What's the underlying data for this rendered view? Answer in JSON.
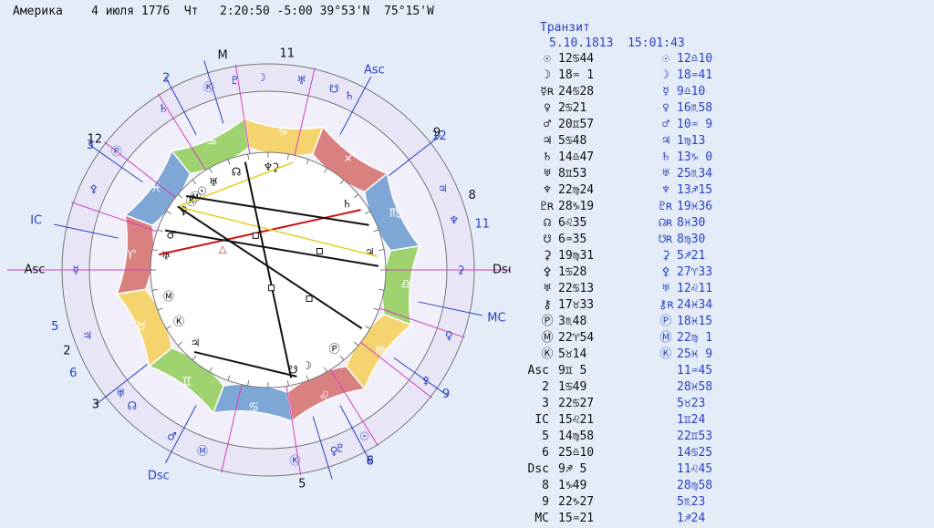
{
  "header": {
    "place": "Америка",
    "date": "4 июля 1776",
    "weekday": "Чт",
    "time": "2:20:50",
    "tz": "-5:00",
    "lat": "39°53'N",
    "lon": "75°15'W"
  },
  "transit": {
    "title": "Транзит",
    "date": "5.10.1813",
    "time": "15:01:43"
  },
  "planets": [
    {
      "sym": "☉",
      "nat": "12♋44",
      "trsym": "☉",
      "tr": "12♎10"
    },
    {
      "sym": "☽",
      "nat": "18♒ 1",
      "trsym": "☽",
      "tr": "18♒41"
    },
    {
      "sym": "☿ʀ",
      "nat": "24♋28",
      "trsym": "☿",
      "tr": "9♎10"
    },
    {
      "sym": "♀",
      "nat": "2♋21",
      "trsym": "♀",
      "tr": "16♏58"
    },
    {
      "sym": "♂",
      "nat": "20♊57",
      "trsym": "♂",
      "tr": "10♒ 9"
    },
    {
      "sym": "♃",
      "nat": "5♋48",
      "trsym": "♃",
      "tr": "1♍13"
    },
    {
      "sym": "♄",
      "nat": "14♎47",
      "trsym": "♄",
      "tr": "13♑ 0"
    },
    {
      "sym": "♅",
      "nat": "8♊53",
      "trsym": "♅",
      "tr": "25♏34"
    },
    {
      "sym": "♆",
      "nat": "22♍24",
      "trsym": "♆",
      "tr": "13♐15"
    },
    {
      "sym": "♇ʀ",
      "nat": "28♑19",
      "trsym": "♇ʀ",
      "tr": "19♓36"
    },
    {
      "sym": "☊",
      "nat": "6♌35",
      "trsym": "☊ʀ",
      "tr": "8♓30"
    },
    {
      "sym": "☋",
      "nat": "6♒35",
      "trsym": "☋ʀ",
      "tr": "8♍30"
    },
    {
      "sym": "⚳",
      "nat": "19♍31",
      "trsym": "⚳",
      "tr": "5♐21"
    },
    {
      "sym": "⚴",
      "nat": "1♋28",
      "trsym": "⚴",
      "tr": "27♈33"
    },
    {
      "sym": "♅",
      "nat": "22♋13",
      "trsym": "♅",
      "tr": "12♌11"
    },
    {
      "sym": "⚷",
      "nat": "17♉33",
      "trsym": "⚷ʀ",
      "tr": "24♓34"
    },
    {
      "sym": "Ⓟ",
      "nat": "3♏48",
      "trsym": "Ⓟ",
      "tr": "18♓15"
    },
    {
      "sym": "Ⓜ",
      "nat": "22♈54",
      "trsym": "Ⓜ",
      "tr": "22♍ 1"
    },
    {
      "sym": "Ⓚ",
      "nat": "5♉14",
      "trsym": "Ⓚ",
      "tr": "25♓ 9"
    }
  ],
  "houses": [
    {
      "label": "Asc",
      "nat": "9♊ 5",
      "tr": "11♒45"
    },
    {
      "label": "2",
      "nat": "1♋49",
      "tr": "28♓58"
    },
    {
      "label": "3",
      "nat": "22♋27",
      "tr": "5♉23"
    },
    {
      "label": "IC",
      "nat": "15♌21",
      "tr": "1♊24"
    },
    {
      "label": "5",
      "nat": "14♍58",
      "tr": "22♊53"
    },
    {
      "label": "6",
      "nat": "25♎10",
      "tr": "14♋25"
    },
    {
      "label": "Dsc",
      "nat": "9♐ 5",
      "tr": "11♌45"
    },
    {
      "label": "8",
      "nat": "1♑49",
      "tr": "28♍58"
    },
    {
      "label": "9",
      "nat": "22♑27",
      "tr": "5♏23"
    },
    {
      "label": "MC",
      "nat": "15♒21",
      "tr": "1♐24"
    }
  ],
  "wheel": {
    "zodiac": [
      "♈",
      "♉",
      "♊",
      "♋",
      "♌",
      "♍",
      "♎",
      "♏",
      "♐",
      "♑",
      "♒",
      "♓"
    ],
    "sign_colors": [
      "#d98080",
      "#f5d470",
      "#9ed36f",
      "#7fa7d6"
    ],
    "natal_house_labels": [
      "Asc",
      "2",
      "3",
      "IC",
      "5",
      "6",
      "Dsc",
      "8",
      "9",
      "M",
      "11",
      "12"
    ],
    "transit_house_labels": [
      "Asc",
      "2",
      "3",
      "IC",
      "5",
      "6",
      "Dsc",
      "8",
      "9",
      "MC",
      "11",
      "12"
    ],
    "aspect_colors": {
      "square": "#d01010",
      "trine": "#e0d020",
      "opposition": "#111111",
      "sextile": "#111111"
    },
    "aspect_glyph": "△"
  }
}
